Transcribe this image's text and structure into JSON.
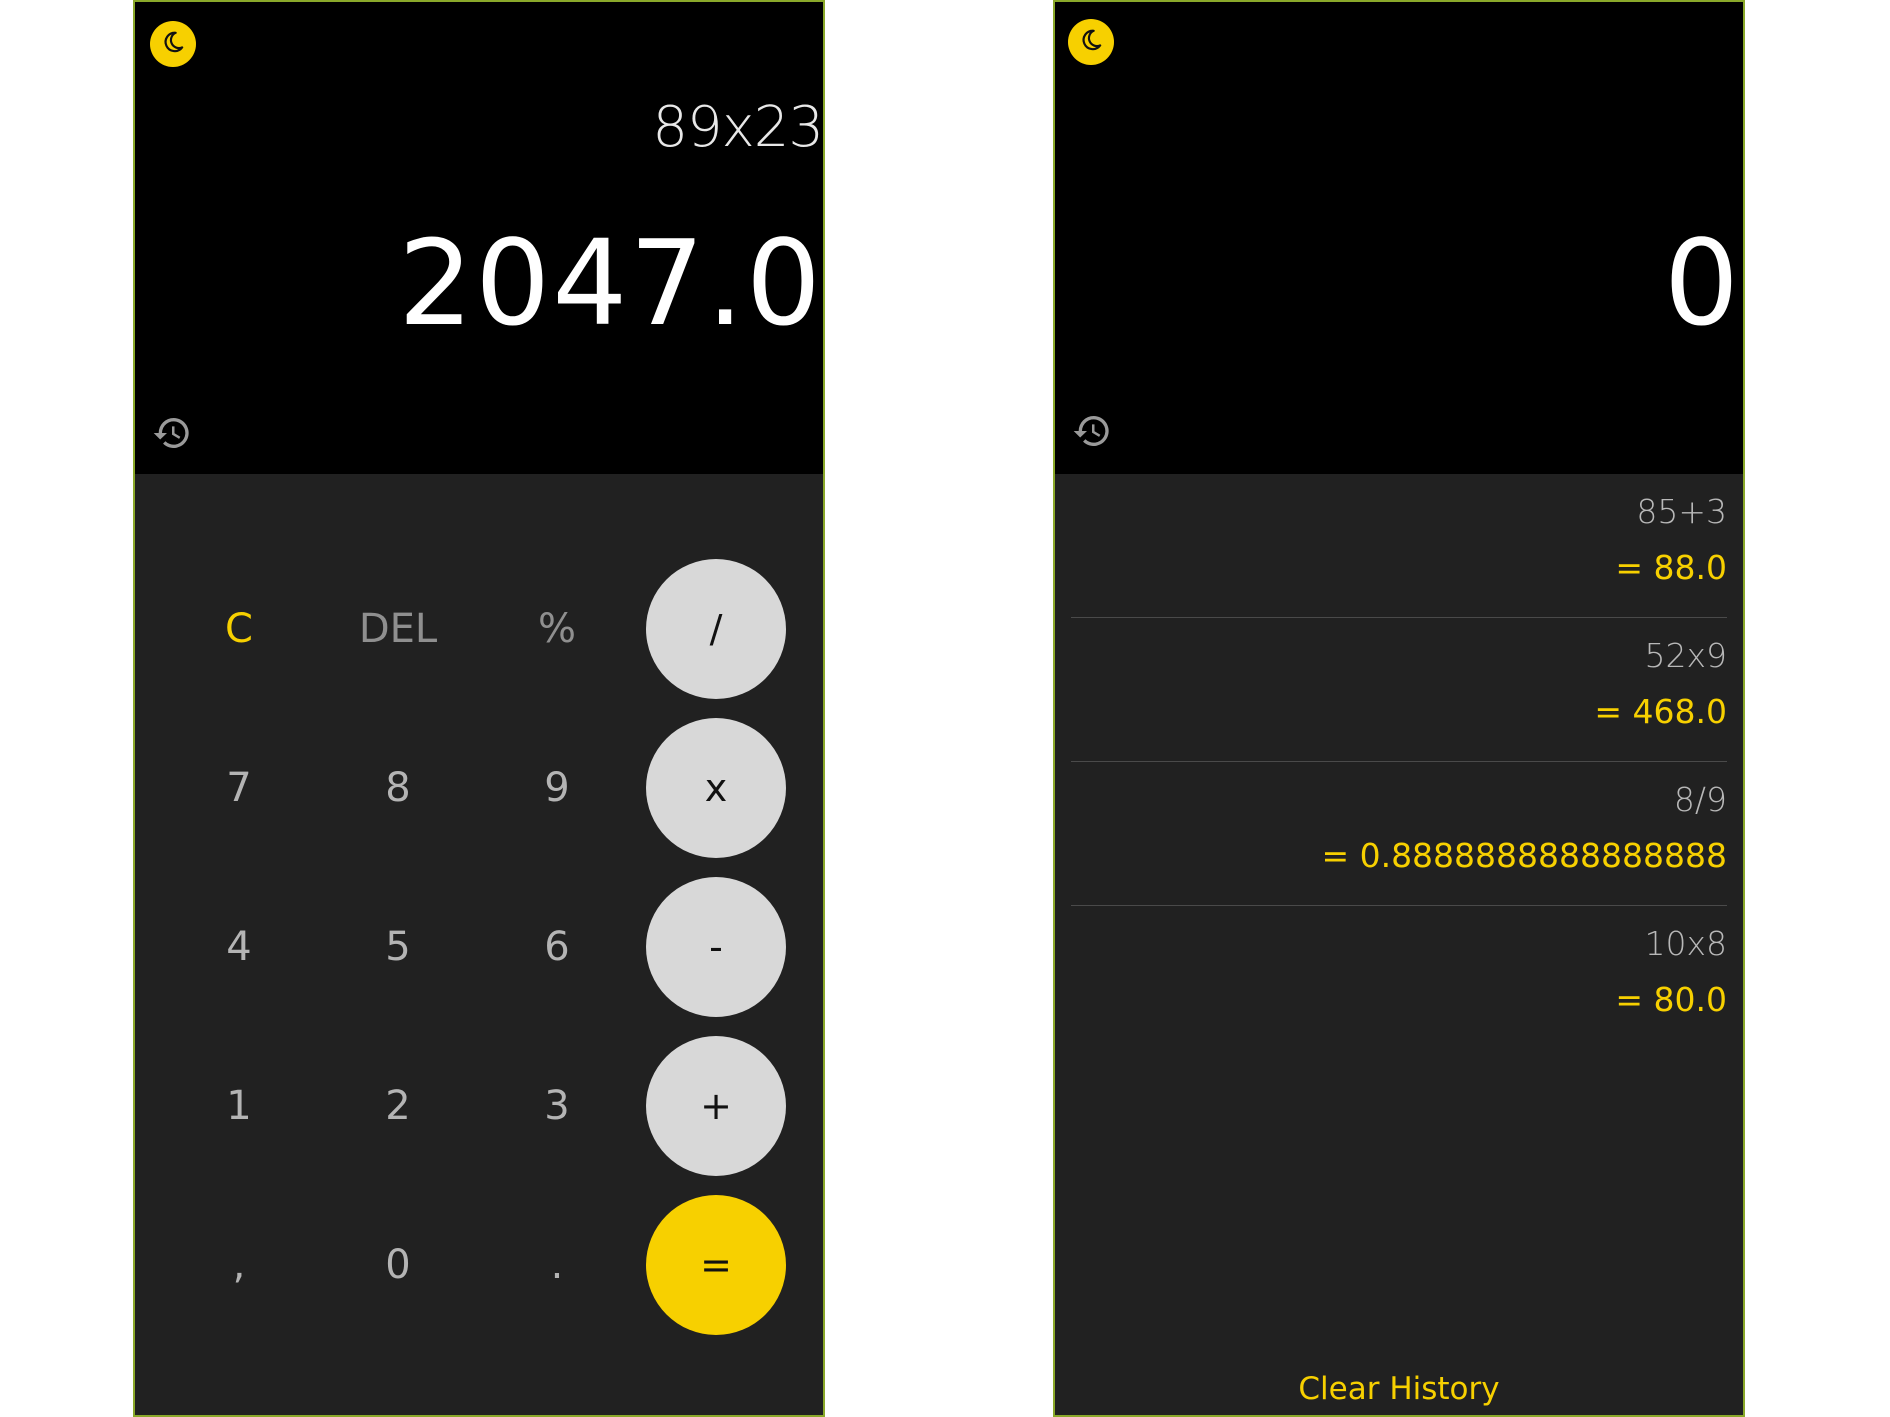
{
  "calculator": {
    "expression": "89x23",
    "result": "2047.0",
    "keys": {
      "clear": "C",
      "delete": "DEL",
      "percent": "%",
      "divide": "/",
      "seven": "7",
      "eight": "8",
      "nine": "9",
      "multiply": "x",
      "four": "4",
      "five": "5",
      "six": "6",
      "subtract": "-",
      "one": "1",
      "two": "2",
      "three": "3",
      "add": "+",
      "comma": ",",
      "zero": "0",
      "dot": ".",
      "equals": "="
    }
  },
  "history_view": {
    "result": "0",
    "entries": [
      {
        "expression": "85+3",
        "result": "= 88.0"
      },
      {
        "expression": "52x9",
        "result": "= 468.0"
      },
      {
        "expression": "8/9",
        "result": "= 0.8888888888888888"
      },
      {
        "expression": "10x8",
        "result": "= 80.0"
      }
    ],
    "clear_label": "Clear History"
  },
  "icons": {
    "theme": "moon-icon",
    "history": "history-icon"
  },
  "colors": {
    "accent": "#f7d000",
    "keypad_bg": "#212121",
    "display_bg": "#000000",
    "operator_key": "#d8d8d8"
  }
}
